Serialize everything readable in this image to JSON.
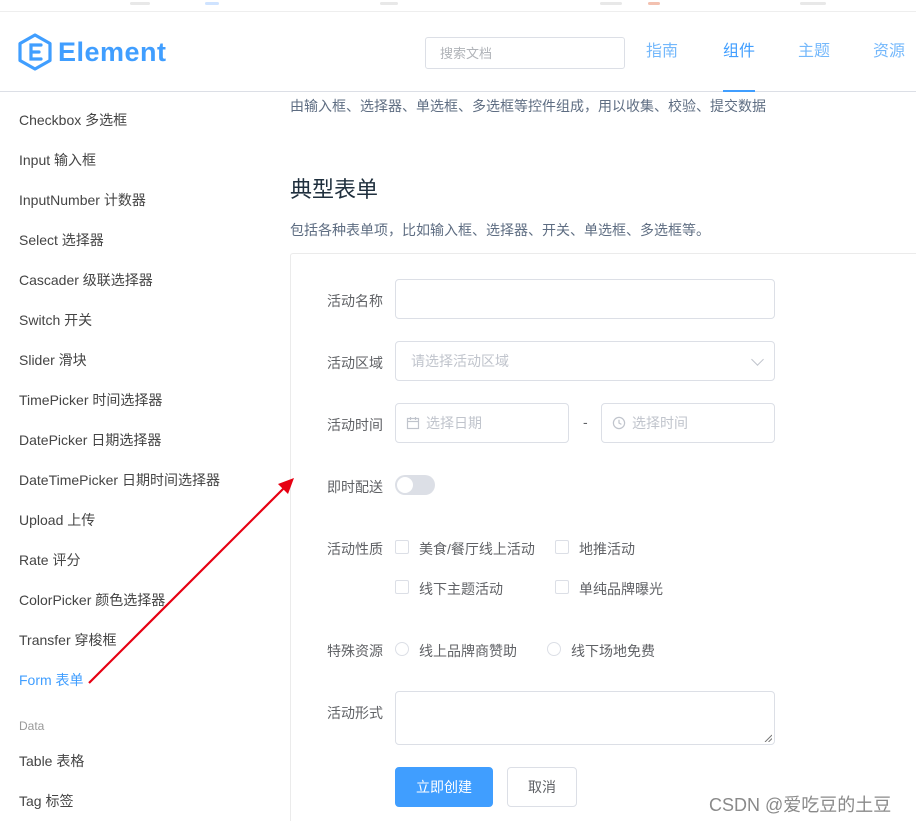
{
  "header": {
    "logo_text": "Element",
    "search_placeholder": "搜索文档",
    "nav": [
      "指南",
      "组件",
      "主题",
      "资源"
    ],
    "active_nav": "组件",
    "accent_color": "#409eff"
  },
  "sidebar": {
    "items": [
      "Checkbox 多选框",
      "Input 输入框",
      "InputNumber 计数器",
      "Select 选择器",
      "Cascader 级联选择器",
      "Switch 开关",
      "Slider 滑块",
      "TimePicker 时间选择器",
      "DatePicker 日期选择器",
      "DateTimePicker 日期时间选择器",
      "Upload 上传",
      "Rate 评分",
      "ColorPicker 颜色选择器",
      "Transfer 穿梭框",
      "Form 表单"
    ],
    "active_item": "Form 表单",
    "group_label": "Data",
    "data_items": [
      "Table 表格",
      "Tag 标签"
    ]
  },
  "main": {
    "intro": "由输入框、选择器、单选框、多选框等控件组成，用以收集、校验、提交数据",
    "section_title": "典型表单",
    "section_desc": "包括各种表单项，比如输入框、选择器、开关、单选框、多选框等。"
  },
  "form": {
    "name_label": "活动名称",
    "name_value": "",
    "region_label": "活动区域",
    "region_placeholder": "请选择活动区域",
    "time_label": "活动时间",
    "date_placeholder": "选择日期",
    "time_separator": "-",
    "time_placeholder": "选择时间",
    "delivery_label": "即时配送",
    "delivery_on": false,
    "type_label": "活动性质",
    "type_options": [
      "美食/餐厅线上活动",
      "地推活动",
      "线下主题活动",
      "单纯品牌曝光"
    ],
    "resource_label": "特殊资源",
    "resource_options": [
      "线上品牌商赞助",
      "线下场地免费"
    ],
    "desc_label": "活动形式",
    "submit_label": "立即创建",
    "cancel_label": "取消"
  },
  "watermark": "CSDN @爱吃豆的土豆",
  "annotation_color": "#e60012"
}
